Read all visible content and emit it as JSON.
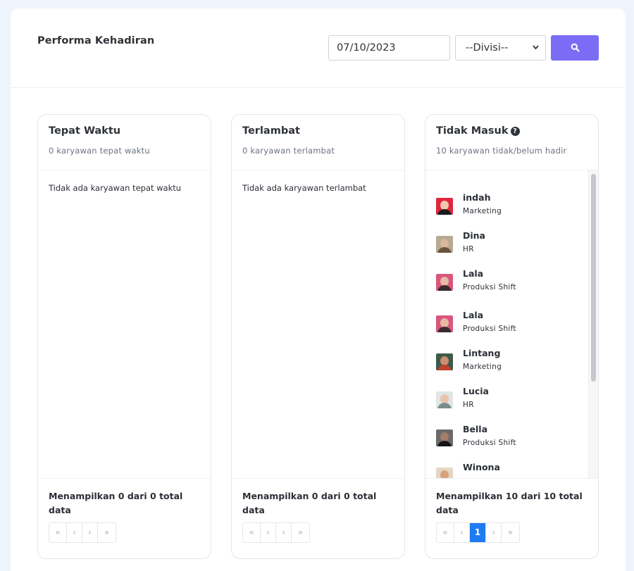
{
  "header": {
    "title": "Performa Kehadiran",
    "date_value": "07/10/2023",
    "division_selected": "--Divisi--",
    "search_icon": "search-icon",
    "accent": "#7b6cf5"
  },
  "columns": [
    {
      "title": "Tepat Waktu",
      "subtitle": "0 karyawan tepat waktu",
      "empty_message": "Tidak ada karyawan tepat waktu",
      "footer": "Menampilkan 0 dari 0 total data",
      "pager": {
        "first": "«",
        "prev": "‹",
        "next": "›",
        "last": "»"
      }
    },
    {
      "title": "Terlambat",
      "subtitle": "0 karyawan terlambat",
      "empty_message": "Tidak ada karyawan terlambat",
      "footer": "Menampilkan 0 dari 0 total data",
      "pager": {
        "first": "«",
        "prev": "‹",
        "next": "›",
        "last": "»"
      }
    },
    {
      "title": "Tidak Masuk",
      "subtitle": "10 karyawan tidak/belum hadir",
      "help_icon": "question-circle-icon",
      "footer": "Menampilkan 10 dari 10 total data",
      "pager": {
        "first": "«",
        "prev": "‹",
        "current": "1",
        "next": "›",
        "last": "»"
      },
      "employees": [
        {
          "name": "indah",
          "division": "Marketing"
        },
        {
          "name": "Dina",
          "division": "HR"
        },
        {
          "name": "Lala",
          "division": "Produksi Shift"
        },
        {
          "name": "Lala",
          "division": "Produksi Shift"
        },
        {
          "name": "Lintang",
          "division": "Marketing"
        },
        {
          "name": "Lucia",
          "division": "HR"
        },
        {
          "name": "Bella",
          "division": "Produksi Shift"
        },
        {
          "name": "Winona",
          "division": ""
        }
      ]
    }
  ]
}
